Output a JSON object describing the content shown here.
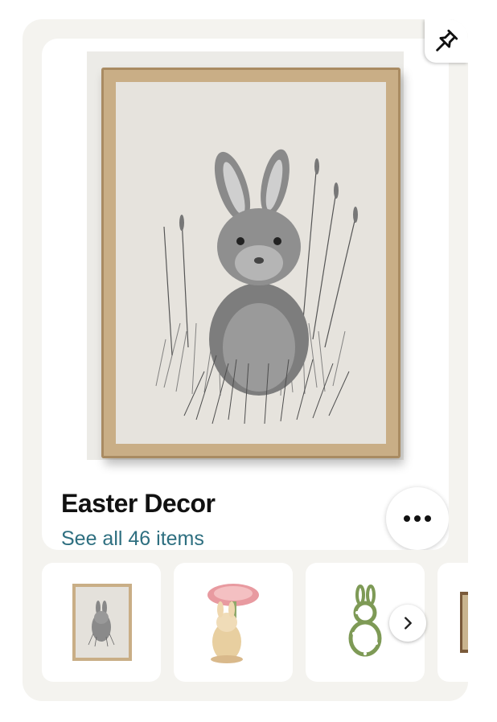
{
  "board": {
    "title": "Easter Decor",
    "see_all": "See all 46 items"
  },
  "icons": {
    "pin": "pushpin-icon",
    "more": "more-dots-icon",
    "next": "chevron-right-icon"
  },
  "colors": {
    "link": "#2e6f80",
    "card_background": "#f4f3ef"
  }
}
